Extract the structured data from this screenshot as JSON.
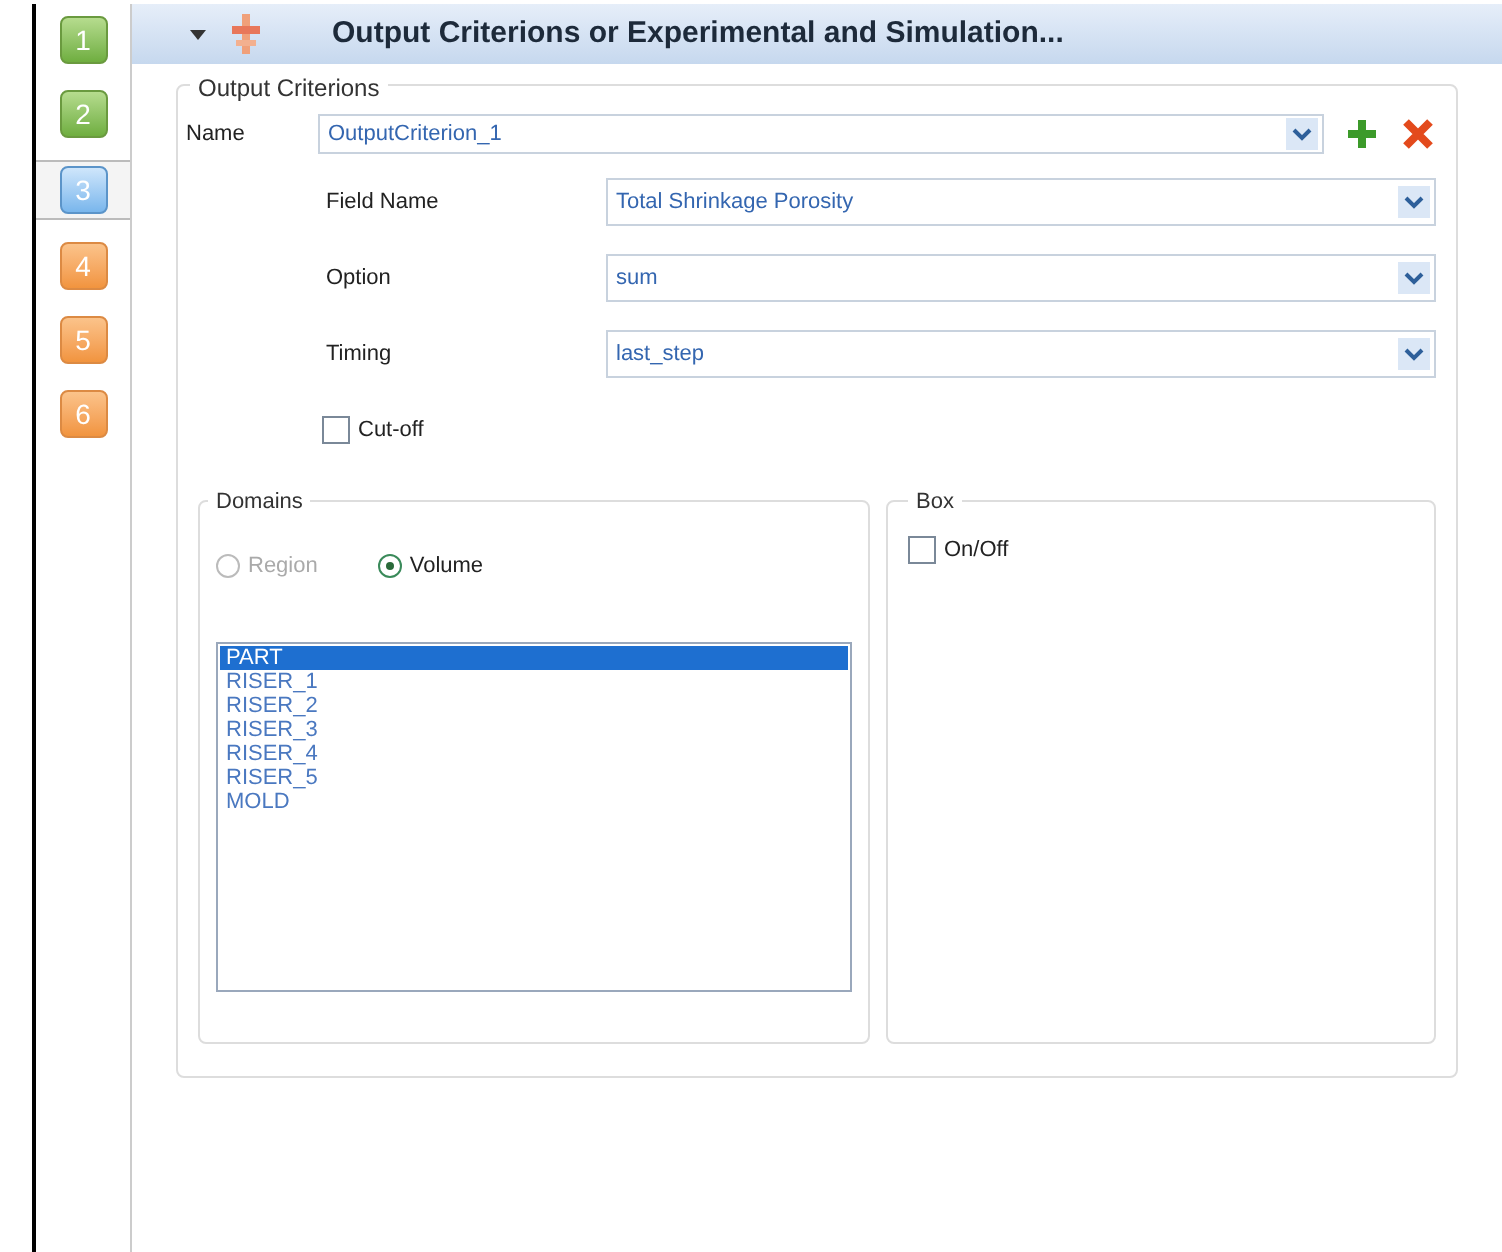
{
  "steps": [
    {
      "label": "1",
      "kind": "done"
    },
    {
      "label": "2",
      "kind": "done"
    },
    {
      "label": "3",
      "kind": "current"
    },
    {
      "label": "4",
      "kind": "todo"
    },
    {
      "label": "5",
      "kind": "todo"
    },
    {
      "label": "6",
      "kind": "todo"
    }
  ],
  "header": {
    "title": "Output Criterions or Experimental and Simulation...",
    "expanded": true
  },
  "output_criterions": {
    "legend": "Output Criterions",
    "name_label": "Name",
    "name_value": "OutputCriterion_1",
    "fields": [
      {
        "label": "Field Name",
        "value": "Total Shrinkage Porosity"
      },
      {
        "label": "Option",
        "value": "sum"
      },
      {
        "label": "Timing",
        "value": "last_step"
      }
    ],
    "cutoff": {
      "label": "Cut-off",
      "checked": false
    }
  },
  "domains": {
    "legend": "Domains",
    "radios": [
      {
        "label": "Region",
        "selected": false,
        "disabled": true
      },
      {
        "label": "Volume",
        "selected": true,
        "disabled": false
      }
    ],
    "items": [
      {
        "label": "PART",
        "selected": true
      },
      {
        "label": "RISER_1",
        "selected": false
      },
      {
        "label": "RISER_2",
        "selected": false
      },
      {
        "label": "RISER_3",
        "selected": false
      },
      {
        "label": "RISER_4",
        "selected": false
      },
      {
        "label": "RISER_5",
        "selected": false
      },
      {
        "label": "MOLD",
        "selected": false
      }
    ]
  },
  "box": {
    "legend": "Box",
    "toggle": {
      "label": "On/Off",
      "checked": false
    }
  }
}
